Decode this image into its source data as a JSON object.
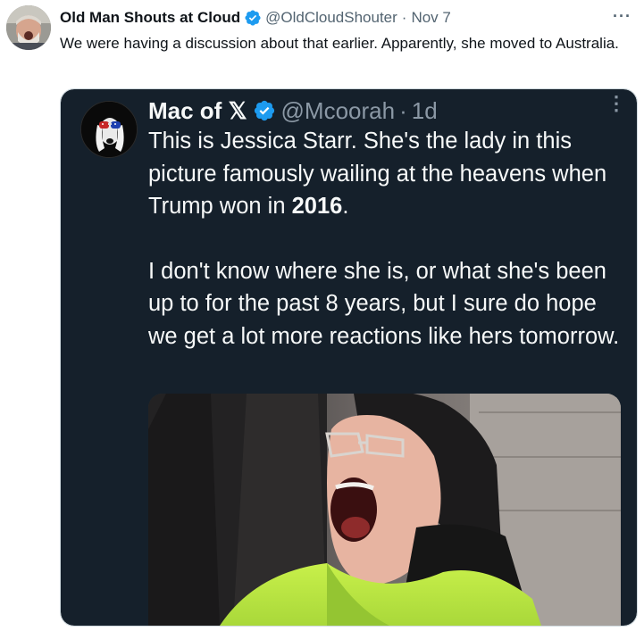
{
  "tweet": {
    "author": {
      "name": "Old Man Shouts at Cloud",
      "handle": "@OldCloudShouter",
      "separator": "·",
      "date": "Nov 7",
      "avatar_icon": "user-avatar-photo",
      "verified_icon": "verified-badge-icon"
    },
    "more_label": "···",
    "text": "We were having a discussion about that earlier. Apparently, she moved to Australia."
  },
  "quoted": {
    "author": {
      "name": "Mac of 𝕏",
      "handle": "@Mcoorah",
      "separator": "·",
      "date": "1d",
      "avatar_icon": "dog-avatar-icon",
      "verified_icon": "verified-badge-icon"
    },
    "more_label": "⋮",
    "text_paragraph_1_before": "This is Jessica Starr. She's the lady in this picture famously wailing at the heavens when Trump won in ",
    "text_paragraph_1_bold": "2016",
    "text_paragraph_1_after": ".",
    "text_paragraph_2": "I don't know where she is, or what she's been up to for the past 8 years, but I sure do hope we get a lot more reactions like hers tomorrow.",
    "media_description_icon": "photo-image"
  },
  "colors": {
    "verified_blue": "#1d9bf0",
    "quoted_background": "#15202b",
    "secondary_text": "#536471"
  }
}
